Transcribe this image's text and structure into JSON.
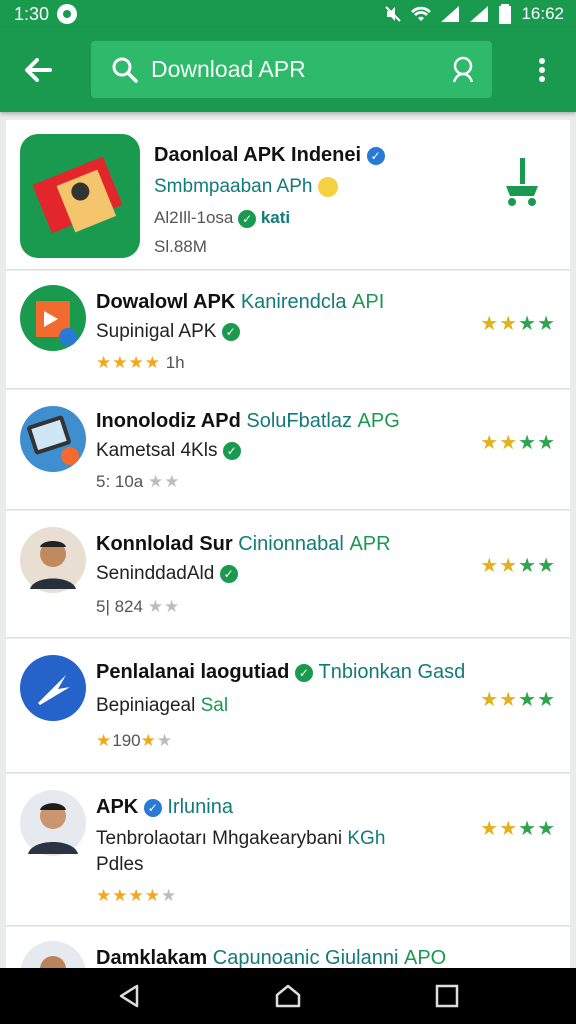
{
  "status": {
    "time": "1:30",
    "clock": "16:62"
  },
  "search": {
    "value": "Download APR"
  },
  "apps": [
    {
      "title": "Daonloal APK Indenei",
      "publisher": "Smbmpaaban APh",
      "info": "Al2Ill-1osa",
      "info2": "kati",
      "size": "Sl.88M"
    },
    {
      "title": "Dowalowl APK",
      "title_accent": "Kanirendcla",
      "title_green": "API",
      "sub": "Supinigal APK",
      "rating_text": "1h"
    },
    {
      "title": "Inonolodiz APd",
      "title_accent": "SoluFbatlaz",
      "title_green": "APG",
      "sub": "Kametsal 4Kls",
      "rating_text": "5: 10a"
    },
    {
      "title": "Konnlolad Sur",
      "title_accent": "Cinionnabal",
      "title_green": "APR",
      "sub": "SeninddadAld",
      "rating_text": "5| 824"
    },
    {
      "title": "Penlalanai laogutiad",
      "title_accent": "Tnbionkan Gasd",
      "sub": "Bepiniageal",
      "sub_green": "Sal",
      "rating_text": "190"
    },
    {
      "title": "APK",
      "title_accent": "Irlunina",
      "sub": "Tenbrolaotarı Mhgakearybani",
      "sub_green": "KGh",
      "sub2": "Pdles"
    },
    {
      "title": "Damklakam",
      "title_accent": "Capunoanic Giulanni",
      "title_green": "APO"
    }
  ],
  "nav": {
    "back": "back-button",
    "home": "home-button",
    "recents": "recents-button"
  },
  "colors": {
    "primary": "#1a9a4f",
    "search_bg": "#2fb96a"
  }
}
